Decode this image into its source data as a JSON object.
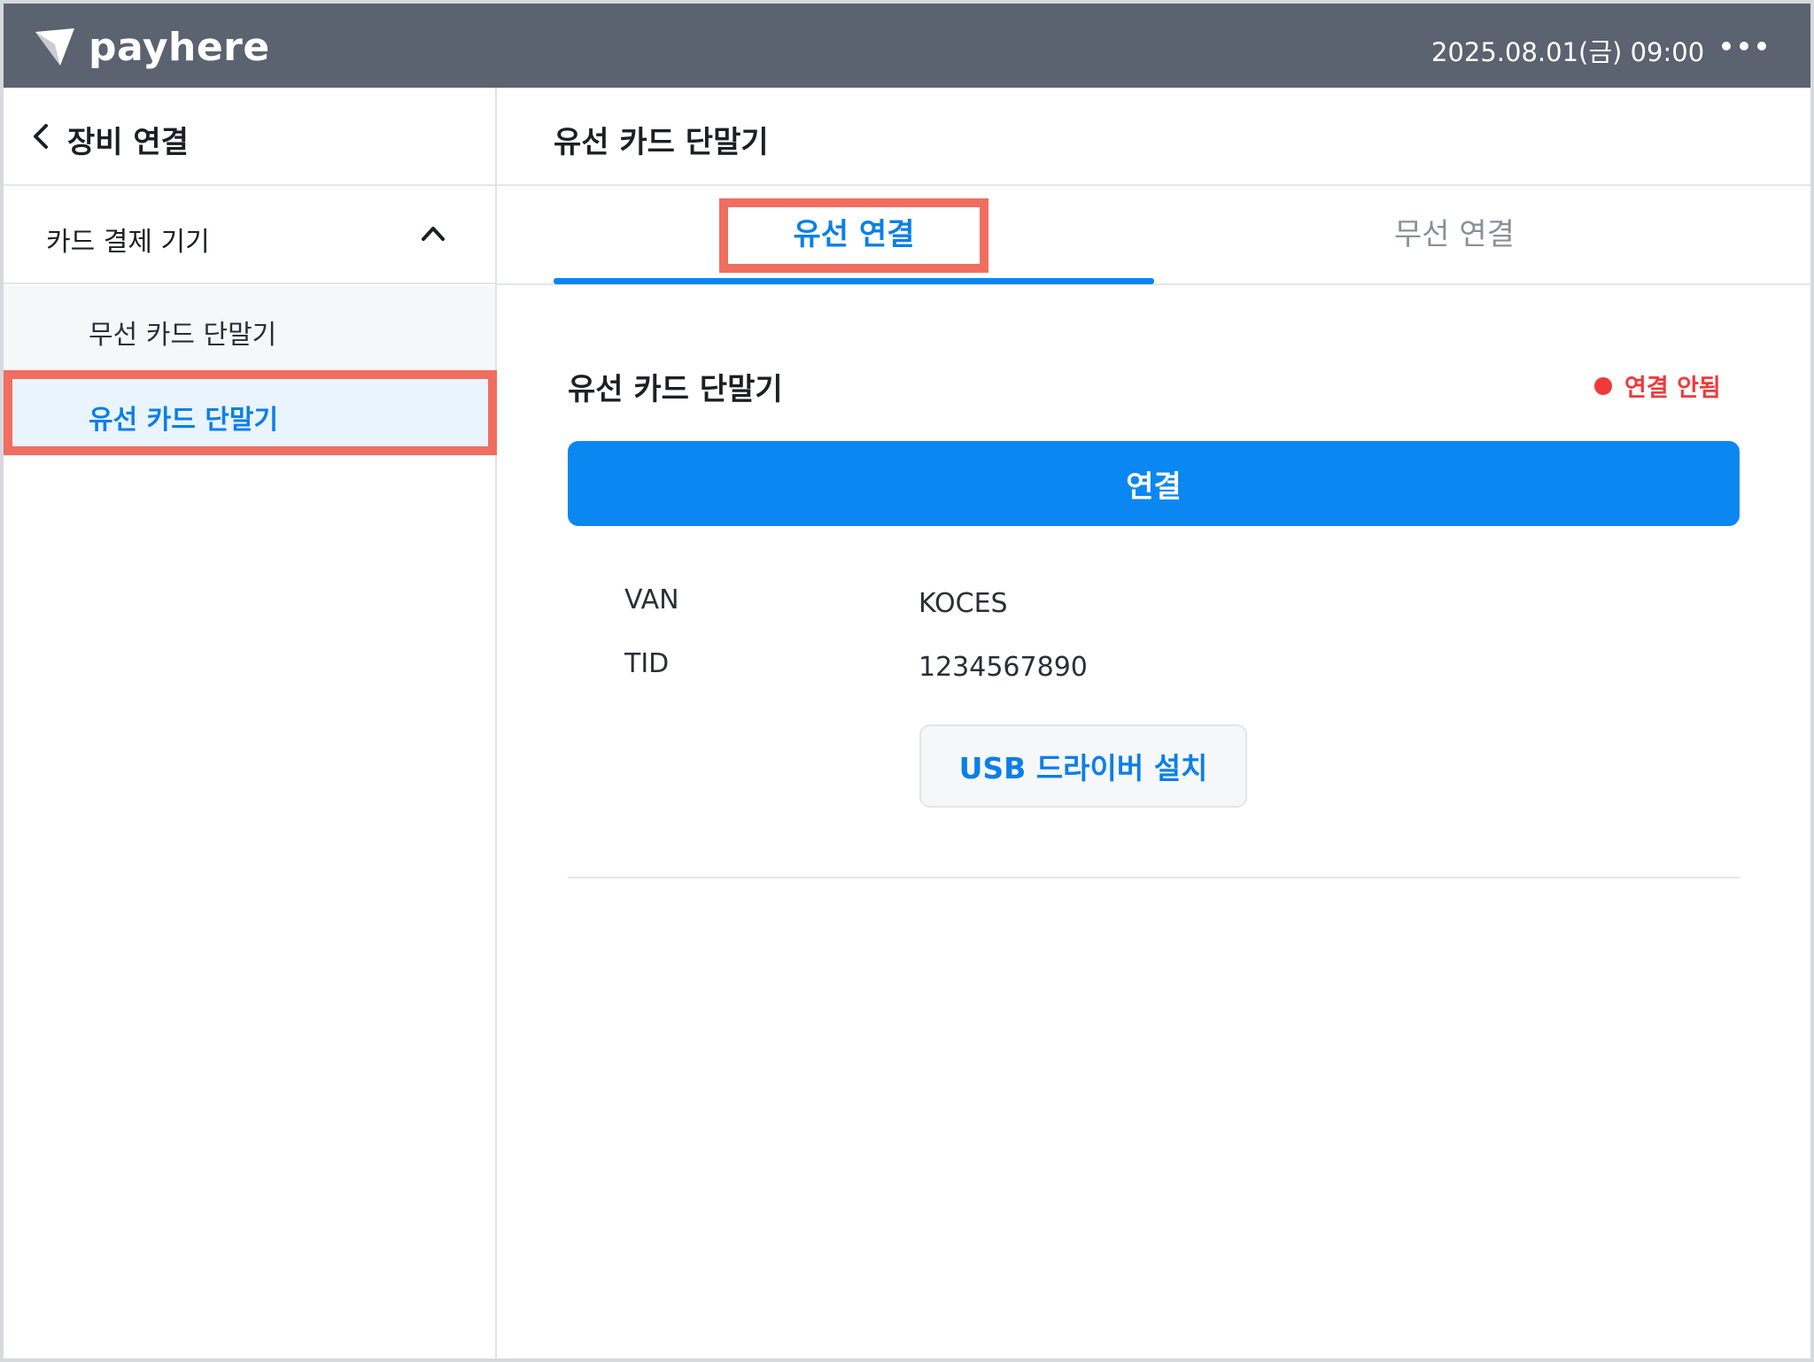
{
  "header": {
    "brand": "payhere",
    "datetime": "2025.08.01(금) 09:00",
    "icons": {
      "logo": "payhere-logo-icon",
      "more": "more-dots-icon"
    }
  },
  "sidebar": {
    "title": "장비 연결",
    "back_icon": "chevron-left-icon",
    "group": {
      "label": "카드 결제 기기",
      "expanded_icon": "chevron-up-icon",
      "items": [
        {
          "label": "무선 카드 단말기",
          "active": false
        },
        {
          "label": "유선 카드 단말기",
          "active": true
        }
      ]
    }
  },
  "main": {
    "title": "유선 카드 단말기",
    "tabs": [
      {
        "label": "유선 연결",
        "selected": true
      },
      {
        "label": "무선 연결",
        "selected": false
      }
    ],
    "device": {
      "title": "유선 카드 단말기",
      "status": "연결 안됨",
      "status_color": "#f03a3a",
      "connect_label": "연결",
      "info": [
        {
          "label": "VAN",
          "value": "KOCES"
        },
        {
          "label": "TID",
          "value": "1234567890"
        }
      ],
      "usb_button_label": "USB 드라이버 설치"
    }
  },
  "colors": {
    "header_bg": "#5b6270",
    "accent": "#0b87f2",
    "highlight": "#f06e60"
  }
}
